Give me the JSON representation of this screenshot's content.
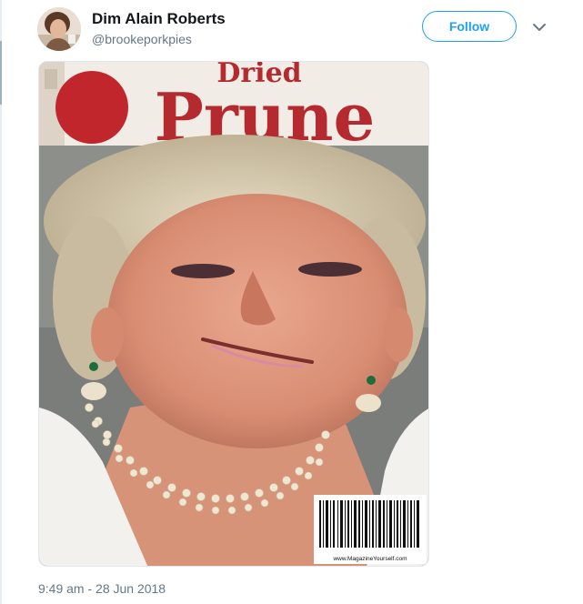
{
  "tweet": {
    "author_name": "Dim Alain Roberts",
    "handle": "@brookeporkpies",
    "follow_label": "Follow",
    "timestamp": "9:49 am - 28 Jun 2018"
  },
  "media": {
    "masthead_top": "Dried",
    "masthead_main": "Prune",
    "barcode_url": "www.MagazineYourself.com"
  },
  "colors": {
    "accent": "#1da1f2",
    "masthead_red": "#b52a2e",
    "text_primary": "#14171a",
    "text_secondary": "#657786"
  },
  "icons": {
    "menu": "chevron-down-icon"
  }
}
